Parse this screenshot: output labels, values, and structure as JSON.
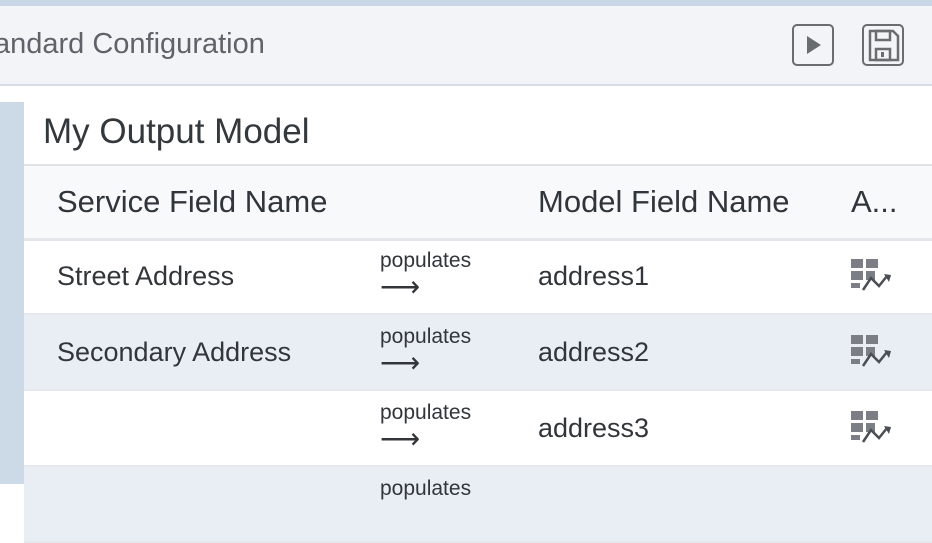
{
  "header": {
    "title": "andard Configuration",
    "run_icon": "play-icon",
    "save_icon": "save-icon"
  },
  "panel": {
    "title": "My Output Model"
  },
  "table": {
    "columns": {
      "service_field": "Service Field Name",
      "model_field": "Model Field Name",
      "actions": "A..."
    },
    "rows": [
      {
        "service": "Street Address",
        "relation": "populates",
        "arrow": "⟶",
        "model": "address1",
        "action_icon": "mapping-icon"
      },
      {
        "service": "Secondary Address",
        "relation": "populates",
        "arrow": "⟶",
        "model": "address2",
        "action_icon": "mapping-icon"
      },
      {
        "service": "",
        "relation": "populates",
        "arrow": "⟶",
        "model": "address3",
        "action_icon": "mapping-icon"
      },
      {
        "service": "",
        "relation": "populates",
        "arrow": "",
        "model": "",
        "action_icon": ""
      }
    ]
  }
}
